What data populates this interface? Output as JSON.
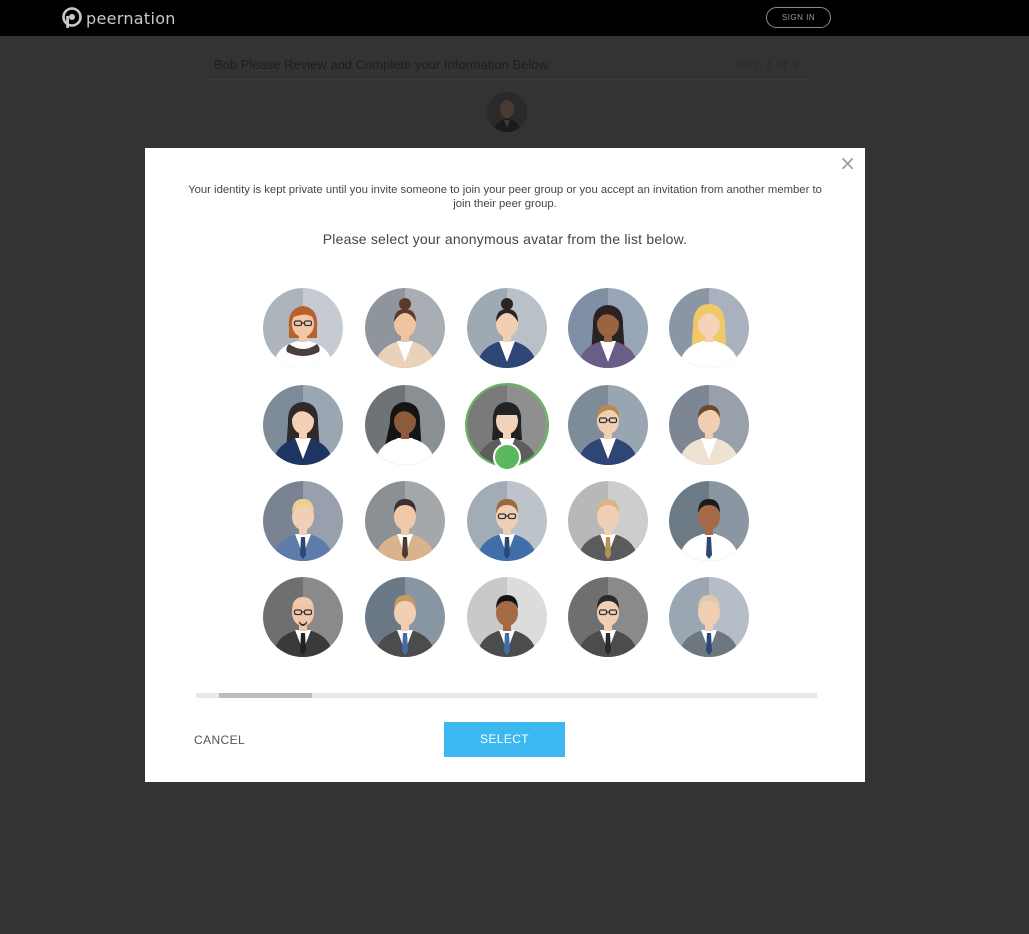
{
  "app": {
    "brand": "peernation",
    "signin_label": "SIGN IN"
  },
  "page": {
    "title": "Bob Please Review and Complete your Information Below.",
    "step": "Step 1 of 3"
  },
  "modal": {
    "close_glyph": "×",
    "privacy_text": "Your identity is kept private until you invite someone to join your peer group or you accept an invitation from another member to join their peer group.",
    "prompt": "Please select your anonymous avatar from the list below.",
    "cancel_label": "CANCEL",
    "select_label": "SELECT",
    "selected_index": 7,
    "scroll_position": 0.04
  },
  "colors": {
    "accent": "#3bb8ef",
    "selected": "#5cb85c",
    "topbar": "#000000",
    "backdrop": "#333333"
  },
  "avatars": [
    {
      "g": "f",
      "bgL": "#adb4bb",
      "bgR": "#c6cbd1",
      "skin": "#f1c7a8",
      "hair": "#b7612d",
      "style": "bob",
      "shirt": "#ffffff",
      "jacket": "#4c3f3a",
      "glasses": true,
      "tie": null,
      "collar": "round"
    },
    {
      "g": "f",
      "bgL": "#8e959c",
      "bgR": "#a9aeb4",
      "skin": "#f0c4a1",
      "hair": "#5b3a2c",
      "style": "bun",
      "shirt": "#ffffff",
      "jacket": "#e8d2ba",
      "glasses": false,
      "tie": null
    },
    {
      "g": "f",
      "bgL": "#9fa9b3",
      "bgR": "#b8c0c8",
      "skin": "#f3cfb2",
      "hair": "#2a2323",
      "style": "bun",
      "shirt": "#ffffff",
      "jacket": "#2e4676",
      "glasses": false,
      "tie": null
    },
    {
      "g": "f",
      "bgL": "#7f8fa4",
      "bgR": "#99a6b8",
      "skin": "#9b6441",
      "hair": "#2a2222",
      "style": "long",
      "shirt": "#ffffff",
      "jacket": "#6a5d86",
      "glasses": false,
      "tie": null
    },
    {
      "g": "f",
      "bgL": "#8b96a4",
      "bgR": "#a8b1bd",
      "skin": "#f5d3b8",
      "hair": "#f0c86a",
      "style": "longblonde",
      "shirt": "#ffffff",
      "jacket": "#ffffff",
      "glasses": false,
      "tie": null
    },
    {
      "g": "f",
      "bgL": "#7d8b99",
      "bgR": "#9aa6b2",
      "skin": "#f3d0b6",
      "hair": "#2e2a2a",
      "style": "long",
      "shirt": "#ffffff",
      "jacket": "#1f3561",
      "glasses": false,
      "tie": null
    },
    {
      "g": "f",
      "bgL": "#6e7377",
      "bgR": "#8a8f93",
      "skin": "#8d5a3b",
      "hair": "#141414",
      "style": "verylong",
      "shirt": "#ffffff",
      "jacket": "#ffffff",
      "glasses": false,
      "tie": null
    },
    {
      "g": "f",
      "bgL": "#7a7a7a",
      "bgR": "#8f8f8f",
      "skin": "#f1d2bb",
      "hair": "#222222",
      "style": "bangs",
      "shirt": "#ffffff",
      "jacket": "#5d5d5d",
      "glasses": false,
      "tie": null
    },
    {
      "g": "f",
      "bgL": "#7e8b98",
      "bgR": "#99a5b1",
      "skin": "#f3cfb2",
      "hair": "#b88a4e",
      "style": "short",
      "shirt": "#ffffff",
      "jacket": "#2e4676",
      "glasses": true,
      "tie": null
    },
    {
      "g": "f",
      "bgL": "#7d8793",
      "bgR": "#97a0ab",
      "skin": "#f3cfb2",
      "hair": "#6b4a32",
      "style": "short",
      "shirt": "#ffffff",
      "jacket": "#efe2d2",
      "glasses": false,
      "tie": null
    },
    {
      "g": "m",
      "bgL": "#7a8393",
      "bgR": "#98a0ae",
      "skin": "#f1cfb4",
      "hair": "#ead288",
      "style": "manshort",
      "shirt": "#ffffff",
      "jacket": "#5f7bab",
      "glasses": false,
      "tie": "#2e4676"
    },
    {
      "g": "m",
      "bgL": "#8c8f93",
      "bgR": "#a5a8ab",
      "skin": "#f0c9ab",
      "hair": "#3b3030",
      "style": "manshort",
      "shirt": "#ffffff",
      "jacket": "#d8b38e",
      "glasses": false,
      "tie": "#4b3a2e"
    },
    {
      "g": "m",
      "bgL": "#a2acb7",
      "bgR": "#bcc3cb",
      "skin": "#f1cfb4",
      "hair": "#9a6a3a",
      "style": "manshort",
      "shirt": "#ffffff",
      "jacket": "#3f6ea9",
      "glasses": true,
      "tie": "#2e4676"
    },
    {
      "g": "m",
      "bgL": "#b8b8b8",
      "bgR": "#cdcdcd",
      "skin": "#f1cfb4",
      "hair": "#d7b780",
      "style": "manshort",
      "shirt": "#ffffff",
      "jacket": "#5b5b5b",
      "glasses": false,
      "tie": "#b79251"
    },
    {
      "g": "m",
      "bgL": "#6c7a86",
      "bgR": "#8a96a1",
      "skin": "#a36a45",
      "hair": "#1b1b1b",
      "style": "manshort",
      "shirt": "#ffffff",
      "jacket": "#ffffff",
      "glasses": false,
      "tie": "#2e4676"
    },
    {
      "g": "m",
      "bgL": "#6f6f6f",
      "bgR": "#8a8a8a",
      "skin": "#efc7a8",
      "hair": "#f0c9aa",
      "style": "bald",
      "shirt": "#ffffff",
      "jacket": "#3a3a3a",
      "glasses": true,
      "tie": "#222222"
    },
    {
      "g": "m",
      "bgL": "#6b7886",
      "bgR": "#8895a2",
      "skin": "#f1cfb4",
      "hair": "#c49b63",
      "style": "manshort",
      "shirt": "#ffffff",
      "jacket": "#4c4c4c",
      "glasses": false,
      "tie": "#3f6ea9"
    },
    {
      "g": "m",
      "bgL": "#c9c9c9",
      "bgR": "#dcdcdc",
      "skin": "#a36a45",
      "hair": "#141414",
      "style": "manshort",
      "shirt": "#ffffff",
      "jacket": "#4c4c4c",
      "glasses": false,
      "tie": "#3f6ea9"
    },
    {
      "g": "m",
      "bgL": "#6f6f6f",
      "bgR": "#8a8a8a",
      "skin": "#f1cfb4",
      "hair": "#2a2a2a",
      "style": "manshort",
      "shirt": "#ffffff",
      "jacket": "#4c4c4c",
      "glasses": true,
      "tie": "#2a2a2a"
    },
    {
      "g": "m",
      "bgL": "#9aa6b2",
      "bgR": "#b5bec8",
      "skin": "#f1cfb4",
      "hair": "#e0c8ae",
      "style": "manshort",
      "shirt": "#ffffff",
      "jacket": "#6e7780",
      "glasses": false,
      "tie": "#2e4676"
    }
  ]
}
